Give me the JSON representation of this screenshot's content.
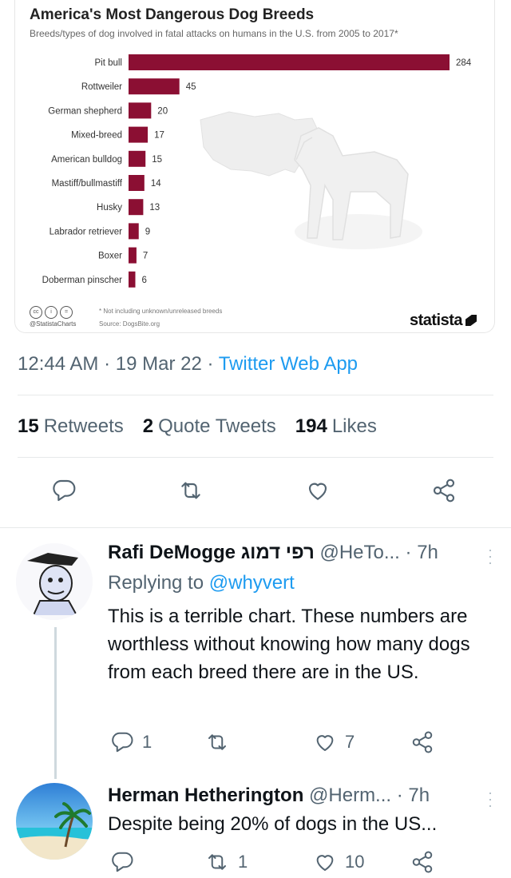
{
  "chart": {
    "title": "America's Most Dangerous Dog Breeds",
    "subtitle": "Breeds/types of dog involved in fatal attacks on humans in the U.S. from 2005 to 2017*",
    "footnote": "* Not including unknown/unreleased breeds",
    "handle": "@StatistaCharts",
    "source": "Source: DogsBite.org",
    "brand": "statista",
    "cc_icons": [
      "cc",
      "i",
      "="
    ],
    "bar_color": "#8b0f33"
  },
  "chart_data": {
    "type": "bar",
    "orientation": "horizontal",
    "title": "America's Most Dangerous Dog Breeds",
    "subtitle": "Breeds/types of dog involved in fatal attacks on humans in the U.S. from 2005 to 2017*",
    "categories": [
      "Pit bull",
      "Rottweiler",
      "German shepherd",
      "Mixed-breed",
      "American bulldog",
      "Mastiff/bullmastiff",
      "Husky",
      "Labrador retriever",
      "Boxer",
      "Doberman pinscher"
    ],
    "values": [
      284,
      45,
      20,
      17,
      15,
      14,
      13,
      9,
      7,
      6
    ],
    "xlim": [
      0,
      284
    ],
    "grid": false,
    "data_labels": true
  },
  "tweet": {
    "time": "12:44 AM",
    "date": "19 Mar 22",
    "app": "Twitter Web App",
    "sep": "·",
    "retweets_count": "15",
    "retweets_label": "Retweets",
    "quotes_count": "2",
    "quotes_label": "Quote Tweets",
    "likes_count": "194",
    "likes_label": "Likes"
  },
  "replies": [
    {
      "name": "Rafi DeMogge רפי דמוג",
      "handle": "@HeTo...",
      "time": "· 7h",
      "replying_label": "Replying to",
      "replying_to": "@whyvert",
      "text": "This is a terrible chart. These numbers are worthless without knowing how many dogs from each breed there are in the US.",
      "reply_count": "1",
      "retweet_count": "",
      "like_count": "7"
    },
    {
      "name": "Herman Hetherington",
      "handle": "@Herm...",
      "time": "· 7h",
      "text": "Despite being 20% of dogs in the US...",
      "reply_count": "",
      "retweet_count": "1",
      "like_count": "10"
    }
  ],
  "colors": {
    "accent": "#1d9bf0",
    "muted": "#536471",
    "text": "#0f1419"
  }
}
